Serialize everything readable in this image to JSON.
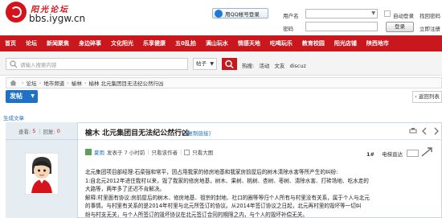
{
  "header": {
    "logo_cn": "阳光论坛",
    "logo_en": "bbs.iygw.cn",
    "qq_login": "用QQ帐号登录",
    "username_label": "用户名",
    "password_label": "密码",
    "autologin_label": "自动登录",
    "register_link": "立即注册",
    "forgot_link": "找回密码",
    "login_button": "登录",
    "username_select": "▼"
  },
  "nav": {
    "items": [
      "首页",
      "论坛",
      "新闻聚焦",
      "身边碎事",
      "文化阳光",
      "乐享健康",
      "五0乱拍",
      "满山玩水",
      "情感天地",
      "吃喝玩乐",
      "教育校园",
      "阳光店铺",
      "陕西地市"
    ]
  },
  "search": {
    "placeholder": "请输入搜索内容",
    "type": "帖子",
    "hot_label": "热搜:",
    "hot_terms": [
      "活动",
      "文友",
      "discuz"
    ]
  },
  "breadcrumb": {
    "items": [
      "论坛",
      "地市频道",
      "榆林",
      "榆林 北元集团目无法纪公然行凶"
    ]
  },
  "actions": {
    "post": "发帖",
    "return": "返回列表"
  },
  "author_section": "生成文章",
  "post": {
    "views_label": "查看:",
    "views": "5",
    "replies_label": "回复:",
    "replies": "0",
    "title": "榆木 北元集团目无法纪公然行凶",
    "copy_link": "[复制链接]",
    "author": "夏雨",
    "posted": "发表于 7 小时前",
    "only_author": "只看该作者",
    "only_image": "只看大图",
    "floor": "1#",
    "jump_label": "电梯直达",
    "body": [
      "北元集团项目部经理:石菜强和常平，因占用我家的修房地基和我家房前屋后的树木清除水害等所产生的纠纷:",
      "1:自北元2012年进住我村以来，毁了我家的修房地基，树木、果树、桃树、杏树、枣树、清除水害、打砖场地、吃水走的",
      "大路等，两年多了还迟不肯解决。",
      "解释:村里面有协议:房前屋后的树木、修房地基、祖宗的封地、社口的圈等等归个人所有与村里没有关系，属于个人与北元",
      "的事情。与村里有关系的是2014年村里与北元所签订的协议。从2014年签订协议之日起，北元再村里的毁坏等一切纠",
      "纷与村支无关，与个人所签订的毁坏协议在北元签订合同的期限之内，与个人的毁坏补偿无关。"
    ]
  }
}
